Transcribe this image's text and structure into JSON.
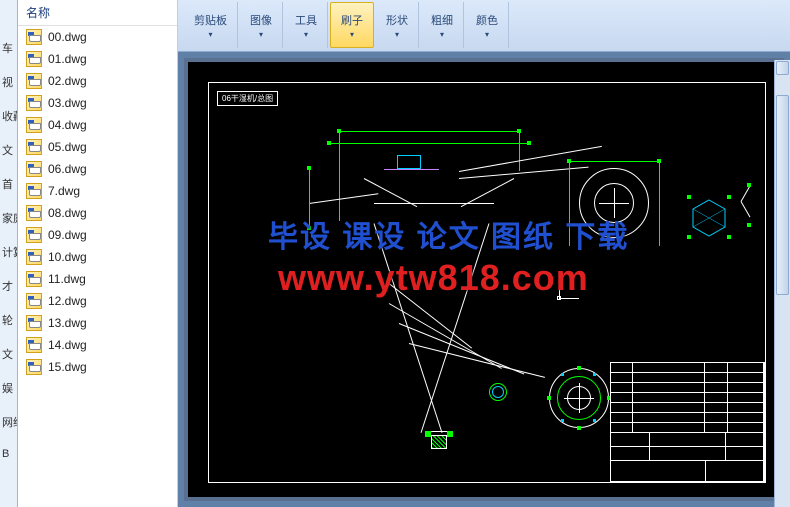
{
  "left_strip": [
    "车",
    "视",
    "收藏",
    "文",
    "首",
    "家庭",
    "计算",
    "才",
    "轮",
    "文",
    "娱",
    "网络",
    "B"
  ],
  "file_panel": {
    "header": "名称",
    "files": [
      "00.dwg",
      "01.dwg",
      "02.dwg",
      "03.dwg",
      "04.dwg",
      "05.dwg",
      "06.dwg",
      "7.dwg",
      "08.dwg",
      "09.dwg",
      "10.dwg",
      "11.dwg",
      "12.dwg",
      "13.dwg",
      "14.dwg",
      "15.dwg"
    ]
  },
  "ribbon": {
    "groups": [
      {
        "label": "剪贴板",
        "name": "clipboard-group"
      },
      {
        "label": "图像",
        "name": "image-group"
      },
      {
        "label": "工具",
        "name": "tools-group"
      },
      {
        "label": "刷子",
        "name": "brush-group",
        "active": true
      },
      {
        "label": "形状",
        "name": "shapes-group"
      },
      {
        "label": "粗细",
        "name": "thickness-group"
      },
      {
        "label": "颜色",
        "name": "colors-group"
      }
    ]
  },
  "drawing": {
    "title_block_text": "06干湿机/总图"
  },
  "watermark": {
    "line1": "毕设 课设 论文 图纸 下载",
    "line2": "www.ytw818.com"
  }
}
